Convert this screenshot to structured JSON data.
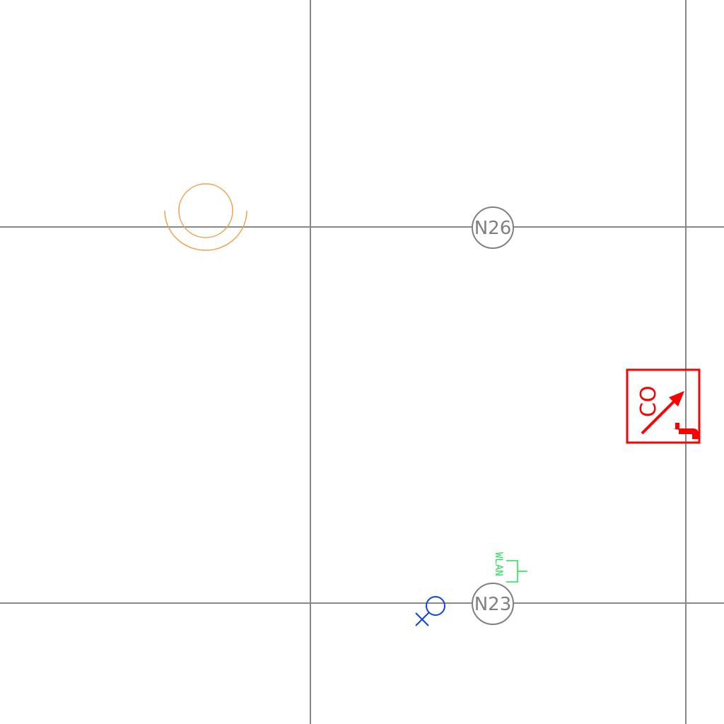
{
  "colors": {
    "background": "#ffffff",
    "grid": "#888888",
    "node": "#808080",
    "orange_symbol": "#f0a050",
    "co_symbol": "#ff0000",
    "wlan_symbol": "#22dd55",
    "blue_symbol": "#1144dd"
  },
  "nodes": {
    "n26": {
      "label": "N26"
    },
    "n23": {
      "label": "N23"
    }
  },
  "symbols": {
    "co_detector": {
      "label": "CO"
    },
    "wlan": {
      "label": "WLAN"
    }
  }
}
